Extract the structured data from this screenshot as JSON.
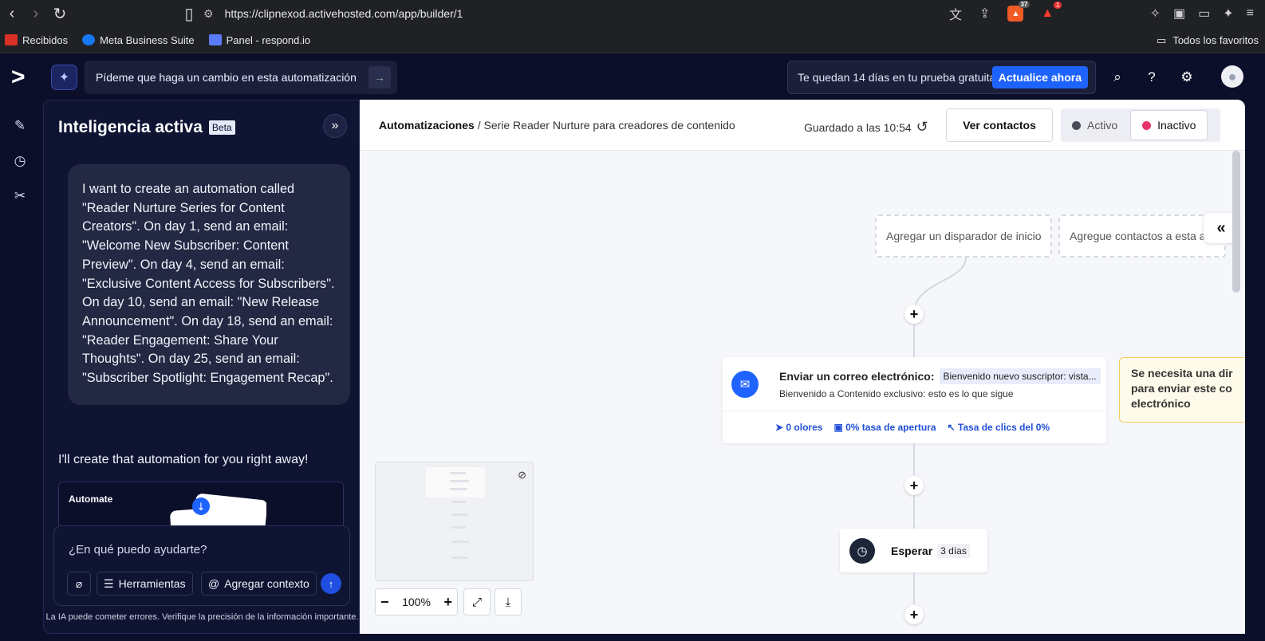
{
  "browser": {
    "url": "https://clipnexod.activehosted.com/app/builder/1",
    "bookmarks": [
      "Recibidos",
      "Meta Business Suite",
      "Panel - respond.io"
    ],
    "all_bookmarks": "Todos los favoritos",
    "brave_count": "37",
    "alert_count": "1"
  },
  "header": {
    "ai_prompt": "Pídeme que haga un cambio en esta automatización",
    "trial_text": "Te quedan 14 días en tu prueba gratuita.",
    "upgrade_label": "Actualice ahora"
  },
  "ai_panel": {
    "title": "Inteligencia activa",
    "beta": "Beta",
    "user_message": "I want to create an automation called \"Reader Nurture Series for Content Creators\". On day 1, send an email: \"Welcome New Subscriber: Content Preview\". On day 4, send an email: \"Exclusive Content Access for Subscribers\". On day 10, send an email: \"New Release Announcement\". On day 18, send an email: \"Reader Engagement: Share Your Thoughts\". On day 25, send an email: \"Subscriber Spotlight: Engagement Recap\".",
    "assistant_message": "I'll create that automation for you right away!",
    "card_label": "Automate",
    "input_placeholder": "¿En qué puedo ayudarte?",
    "tools_label": "Herramientas",
    "context_label": "Agregar contexto",
    "disclaimer": "La IA puede cometer errores. Verifique la precisión de la información importante."
  },
  "builder": {
    "breadcrumb_root": "Automatizaciones",
    "breadcrumb_separator": " / ",
    "breadcrumb_current": "Serie Reader Nurture para creadores de contenido",
    "saved_text": "Guardado a las 10:54",
    "view_contacts": "Ver contactos",
    "status_active": "Activo",
    "status_inactive": "Inactivo",
    "trigger_start": "Agregar un disparador de inicio",
    "trigger_add": "Agregue contactos a esta a",
    "email": {
      "title": "Enviar un correo electrónico:",
      "tag": "Bienvenido nuevo suscriptor: vista...",
      "subject": "Bienvenido a Contenido exclusivo: esto es lo que sigue",
      "stat_sent": "0 olores",
      "stat_open": "0% tasa de apertura",
      "stat_click": "Tasa de clics del 0%"
    },
    "warning": "Se necesita una dir para enviar este co electrónico",
    "wait": {
      "label": "Esperar",
      "tag": "3 días"
    },
    "zoom": "100%"
  },
  "colors": {
    "brand_dark": "#0b0f2a",
    "accent_blue": "#1f63ff",
    "inactive_dot": "#e8336a",
    "active_dot": "#4a4d57",
    "warn_bg": "#fffbea"
  }
}
